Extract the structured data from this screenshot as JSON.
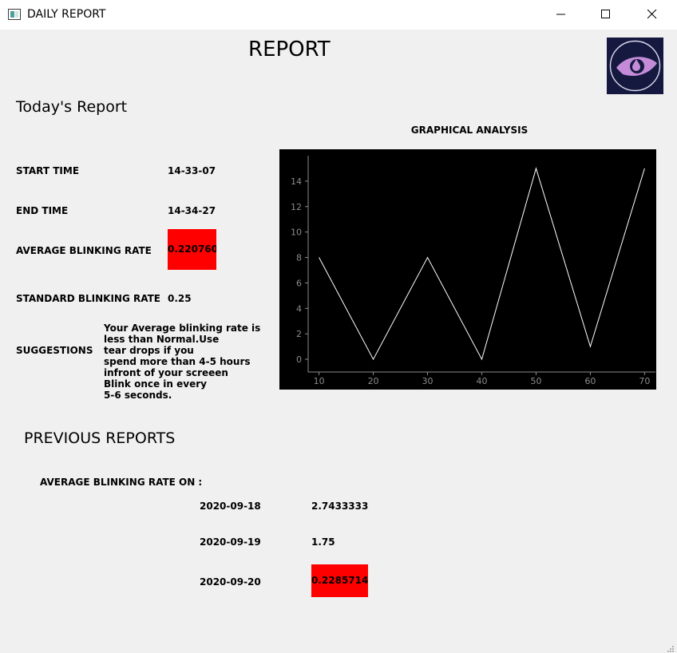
{
  "window": {
    "title": "DAILY REPORT",
    "controls": [
      "minimize-icon",
      "maximize-icon",
      "close-icon"
    ]
  },
  "header": {
    "title": "REPORT",
    "logo_icon": "eye-logo-icon"
  },
  "today": {
    "heading": "Today's Report",
    "start_time_label": "START TIME",
    "start_time_value": "14-33-07",
    "end_time_label": "END TIME",
    "end_time_value": "14-34-27",
    "avg_rate_label": "AVERAGE BLINKING RATE",
    "avg_rate_value": "0.220760",
    "standard_rate_label": "STANDARD BLINKING RATE",
    "standard_rate_value": "0.25",
    "suggestions_label": "SUGGESTIONS",
    "suggestion_lines": [
      "Your Average blinking rate is",
      "less than Normal.Use",
      "tear drops if you",
      "spend more than 4-5 hours",
      "infront of your screeen",
      "Blink once in every",
      "5-6 seconds."
    ]
  },
  "graph": {
    "title": "GRAPHICAL ANALYSIS"
  },
  "chart_data": {
    "type": "line",
    "title": "GRAPHICAL ANALYSIS",
    "xlabel": "",
    "ylabel": "",
    "x": [
      10,
      20,
      30,
      40,
      50,
      60,
      70
    ],
    "series": [
      {
        "values": [
          8,
          0,
          8,
          0,
          15,
          1,
          15
        ]
      }
    ],
    "xticks": [
      "10",
      "20",
      "30",
      "40",
      "50",
      "60",
      "70"
    ],
    "yticks": [
      "0",
      "2",
      "4",
      "6",
      "8",
      "10",
      "12",
      "14"
    ],
    "xlim": [
      8,
      72
    ],
    "ylim": [
      -1,
      16
    ],
    "grid": false,
    "background": "#000000",
    "line_color": "#ffffff",
    "tick_color": "#8c8c8c"
  },
  "previous": {
    "heading": "PREVIOUS REPORTS",
    "avg_label": "AVERAGE BLINKING RATE ON :",
    "rows": [
      {
        "date": "2020-09-18",
        "value": "2.74333333",
        "highlight": false
      },
      {
        "date": "2020-09-19",
        "value": "1.75",
        "highlight": false
      },
      {
        "date": "2020-09-20",
        "value": "0.22857142",
        "highlight": true
      }
    ]
  },
  "colors": {
    "background": "#f0f0f0",
    "alert": "#ff0000",
    "logo_bg": "#15193f",
    "logo_eye": "#c48cd8"
  }
}
